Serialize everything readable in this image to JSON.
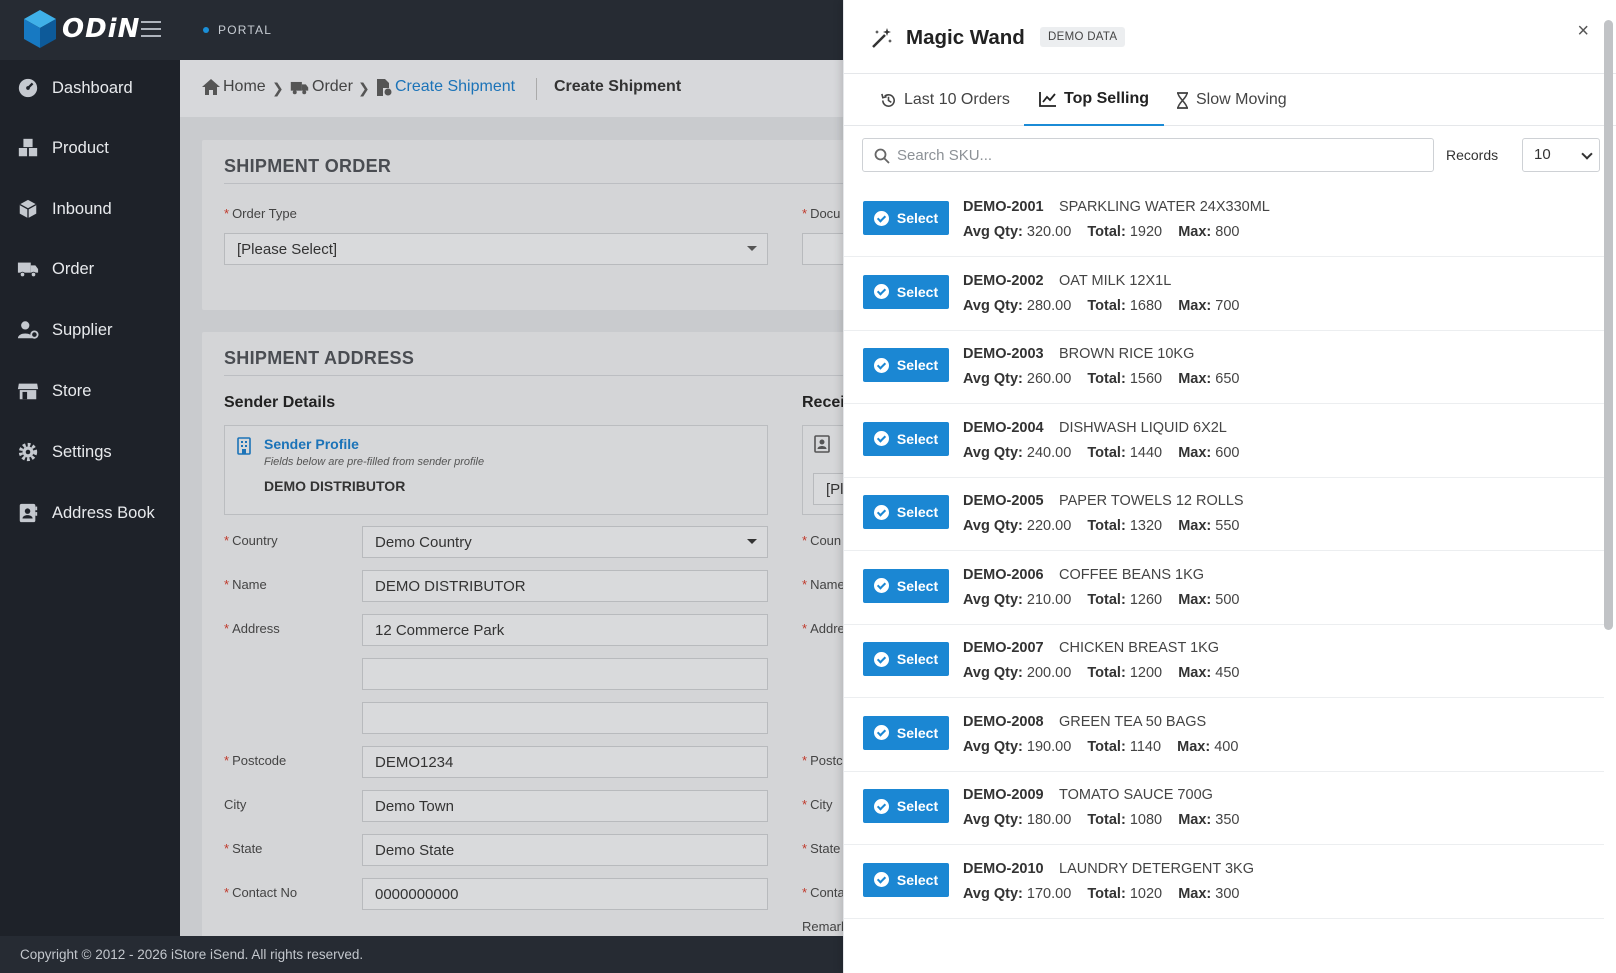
{
  "app": {
    "logo_text": "ODiN",
    "portal_label": "PORTAL"
  },
  "sidebar": {
    "items": [
      {
        "label": "Dashboard",
        "icon": "dashboard-icon"
      },
      {
        "label": "Product",
        "icon": "boxes-icon"
      },
      {
        "label": "Inbound",
        "icon": "box-icon"
      },
      {
        "label": "Order",
        "icon": "truck-icon"
      },
      {
        "label": "Supplier",
        "icon": "user-cog-icon"
      },
      {
        "label": "Store",
        "icon": "store-icon"
      },
      {
        "label": "Settings",
        "icon": "gear-icon"
      },
      {
        "label": "Address Book",
        "icon": "address-book-icon"
      }
    ]
  },
  "breadcrumb": {
    "home": "Home",
    "order": "Order",
    "create": "Create Shipment",
    "title": "Create Shipment"
  },
  "shipment_order": {
    "title": "SHIPMENT ORDER",
    "order_type_label": "Order Type",
    "order_type_value": "[Please Select]",
    "document_label": "Docu"
  },
  "shipment_address": {
    "title": "SHIPMENT ADDRESS",
    "sender_heading": "Sender Details",
    "receiver_heading": "Recei",
    "sender_profile": {
      "title": "Sender Profile",
      "note": "Fields below are pre-filled from sender profile",
      "name": "DEMO DISTRIBUTOR"
    },
    "receiver_select_partial": "[Pl",
    "fields": {
      "country_label": "Country",
      "country_value": "Demo Country",
      "name_label": "Name",
      "name_value": "DEMO DISTRIBUTOR",
      "address_label": "Address",
      "address_value": "12 Commerce Park",
      "postcode_label": "Postcode",
      "postcode_value": "DEMO1234",
      "city_label": "City",
      "city_value": "Demo Town",
      "state_label": "State",
      "state_value": "Demo State",
      "contact_label": "Contact No",
      "contact_value": "0000000000"
    },
    "receiver_labels": {
      "country": "Coun",
      "name": "Name",
      "address": "Addre",
      "postcode": "Postc",
      "city": "City",
      "state": "State",
      "contact": "Conta",
      "remark": "Remark"
    }
  },
  "footer": {
    "text": "Copyright © 2012 - 2026 iStore iSend. All rights reserved."
  },
  "panel": {
    "title": "Magic Wand",
    "badge": "DEMO DATA",
    "close": "×",
    "tabs": [
      {
        "label": "Last 10 Orders",
        "icon": "history-icon"
      },
      {
        "label": "Top Selling",
        "icon": "chart-line-icon"
      },
      {
        "label": "Slow Moving",
        "icon": "hourglass-icon"
      }
    ],
    "search_placeholder": "Search SKU...",
    "records_label": "Records",
    "records_value": "10",
    "select_label": "Select",
    "avg_label": "Avg Qty:",
    "total_label": "Total:",
    "max_label": "Max:",
    "items": [
      {
        "sku": "DEMO-2001",
        "desc": "SPARKLING WATER 24X330ML",
        "avg": "320.00",
        "total": "1920",
        "max": "800"
      },
      {
        "sku": "DEMO-2002",
        "desc": "OAT MILK 12X1L",
        "avg": "280.00",
        "total": "1680",
        "max": "700"
      },
      {
        "sku": "DEMO-2003",
        "desc": "BROWN RICE 10KG",
        "avg": "260.00",
        "total": "1560",
        "max": "650"
      },
      {
        "sku": "DEMO-2004",
        "desc": "DISHWASH LIQUID 6X2L",
        "avg": "240.00",
        "total": "1440",
        "max": "600"
      },
      {
        "sku": "DEMO-2005",
        "desc": "PAPER TOWELS 12 ROLLS",
        "avg": "220.00",
        "total": "1320",
        "max": "550"
      },
      {
        "sku": "DEMO-2006",
        "desc": "COFFEE BEANS 1KG",
        "avg": "210.00",
        "total": "1260",
        "max": "500"
      },
      {
        "sku": "DEMO-2007",
        "desc": "CHICKEN BREAST 1KG",
        "avg": "200.00",
        "total": "1200",
        "max": "450"
      },
      {
        "sku": "DEMO-2008",
        "desc": "GREEN TEA 50 BAGS",
        "avg": "190.00",
        "total": "1140",
        "max": "400"
      },
      {
        "sku": "DEMO-2009",
        "desc": "TOMATO SAUCE 700G",
        "avg": "180.00",
        "total": "1080",
        "max": "350"
      },
      {
        "sku": "DEMO-2010",
        "desc": "LAUNDRY DETERGENT 3KG",
        "avg": "170.00",
        "total": "1020",
        "max": "300"
      }
    ]
  },
  "colors": {
    "accent": "#1b87d3",
    "sidebar_bg": "#1e2229",
    "required": "#c0392b"
  }
}
